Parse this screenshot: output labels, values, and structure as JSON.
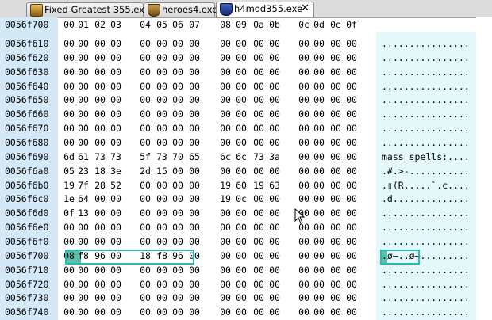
{
  "tabs": [
    {
      "label": "Fixed Greatest 355.exe",
      "active": false
    },
    {
      "label": "heroes4.exe",
      "active": false
    },
    {
      "label": "h4mod355.exe",
      "active": true
    }
  ],
  "header": {
    "current_offset": "0056f700",
    "columns": [
      "00",
      "01",
      "02",
      "03",
      "04",
      "05",
      "06",
      "07",
      "08",
      "09",
      "0a",
      "0b",
      "0c",
      "0d",
      "0e",
      "0f"
    ]
  },
  "rows": [
    {
      "addr": "0056f610",
      "bytes": [
        "00",
        "00",
        "00",
        "00",
        "00",
        "00",
        "00",
        "00",
        "00",
        "00",
        "00",
        "00",
        "00",
        "00",
        "00",
        "00"
      ],
      "ascii": "................"
    },
    {
      "addr": "0056f620",
      "bytes": [
        "00",
        "00",
        "00",
        "00",
        "00",
        "00",
        "00",
        "00",
        "00",
        "00",
        "00",
        "00",
        "00",
        "00",
        "00",
        "00"
      ],
      "ascii": "................"
    },
    {
      "addr": "0056f630",
      "bytes": [
        "00",
        "00",
        "00",
        "00",
        "00",
        "00",
        "00",
        "00",
        "00",
        "00",
        "00",
        "00",
        "00",
        "00",
        "00",
        "00"
      ],
      "ascii": "................"
    },
    {
      "addr": "0056f640",
      "bytes": [
        "00",
        "00",
        "00",
        "00",
        "00",
        "00",
        "00",
        "00",
        "00",
        "00",
        "00",
        "00",
        "00",
        "00",
        "00",
        "00"
      ],
      "ascii": "................"
    },
    {
      "addr": "0056f650",
      "bytes": [
        "00",
        "00",
        "00",
        "00",
        "00",
        "00",
        "00",
        "00",
        "00",
        "00",
        "00",
        "00",
        "00",
        "00",
        "00",
        "00"
      ],
      "ascii": "................"
    },
    {
      "addr": "0056f660",
      "bytes": [
        "00",
        "00",
        "00",
        "00",
        "00",
        "00",
        "00",
        "00",
        "00",
        "00",
        "00",
        "00",
        "00",
        "00",
        "00",
        "00"
      ],
      "ascii": "................"
    },
    {
      "addr": "0056f670",
      "bytes": [
        "00",
        "00",
        "00",
        "00",
        "00",
        "00",
        "00",
        "00",
        "00",
        "00",
        "00",
        "00",
        "00",
        "00",
        "00",
        "00"
      ],
      "ascii": "................"
    },
    {
      "addr": "0056f680",
      "bytes": [
        "00",
        "00",
        "00",
        "00",
        "00",
        "00",
        "00",
        "00",
        "00",
        "00",
        "00",
        "00",
        "00",
        "00",
        "00",
        "00"
      ],
      "ascii": "................"
    },
    {
      "addr": "0056f690",
      "bytes": [
        "6d",
        "61",
        "73",
        "73",
        "5f",
        "73",
        "70",
        "65",
        "6c",
        "6c",
        "73",
        "3a",
        "00",
        "00",
        "00",
        "00"
      ],
      "ascii": "mass_spells:...."
    },
    {
      "addr": "0056f6a0",
      "bytes": [
        "05",
        "23",
        "18",
        "3e",
        "2d",
        "15",
        "00",
        "00",
        "00",
        "00",
        "00",
        "00",
        "00",
        "00",
        "00",
        "00"
      ],
      "ascii": ".#.>-..........."
    },
    {
      "addr": "0056f6b0",
      "bytes": [
        "19",
        "7f",
        "28",
        "52",
        "00",
        "00",
        "00",
        "00",
        "19",
        "60",
        "19",
        "63",
        "00",
        "00",
        "00",
        "00"
      ],
      "ascii": ".▯(R.....`.c...."
    },
    {
      "addr": "0056f6c0",
      "bytes": [
        "1e",
        "64",
        "00",
        "00",
        "00",
        "00",
        "00",
        "00",
        "19",
        "0c",
        "00",
        "00",
        "00",
        "00",
        "00",
        "00"
      ],
      "ascii": ".d.............."
    },
    {
      "addr": "0056f6d0",
      "bytes": [
        "0f",
        "13",
        "00",
        "00",
        "00",
        "00",
        "00",
        "00",
        "00",
        "00",
        "00",
        "00",
        "00",
        "00",
        "00",
        "00"
      ],
      "ascii": "................"
    },
    {
      "addr": "0056f6e0",
      "bytes": [
        "00",
        "00",
        "00",
        "00",
        "00",
        "00",
        "00",
        "00",
        "00",
        "00",
        "00",
        "00",
        "00",
        "00",
        "00",
        "00"
      ],
      "ascii": "................"
    },
    {
      "addr": "0056f6f0",
      "bytes": [
        "00",
        "00",
        "00",
        "00",
        "00",
        "00",
        "00",
        "00",
        "00",
        "00",
        "00",
        "00",
        "00",
        "00",
        "00",
        "00"
      ],
      "ascii": "................"
    },
    {
      "addr": "0056f700",
      "bytes": [
        "08",
        "f8",
        "96",
        "00",
        "18",
        "f8",
        "96",
        "00",
        "00",
        "00",
        "00",
        "00",
        "00",
        "00",
        "00",
        "00"
      ],
      "ascii": ".ø–..ø–........."
    },
    {
      "addr": "0056f710",
      "bytes": [
        "00",
        "00",
        "00",
        "00",
        "00",
        "00",
        "00",
        "00",
        "00",
        "00",
        "00",
        "00",
        "00",
        "00",
        "00",
        "00"
      ],
      "ascii": "................"
    },
    {
      "addr": "0056f720",
      "bytes": [
        "00",
        "00",
        "00",
        "00",
        "00",
        "00",
        "00",
        "00",
        "00",
        "00",
        "00",
        "00",
        "00",
        "00",
        "00",
        "00"
      ],
      "ascii": "................"
    },
    {
      "addr": "0056f730",
      "bytes": [
        "00",
        "00",
        "00",
        "00",
        "00",
        "00",
        "00",
        "00",
        "00",
        "00",
        "00",
        "00",
        "00",
        "00",
        "00",
        "00"
      ],
      "ascii": "................"
    },
    {
      "addr": "0056f740",
      "bytes": [
        "00",
        "00",
        "00",
        "00",
        "00",
        "00",
        "00",
        "00",
        "00",
        "00",
        "00",
        "00",
        "00",
        "00",
        "00",
        "00"
      ],
      "ascii": "................"
    }
  ],
  "colors": {
    "address_column": "#d4e9f7",
    "ascii_panel": "#e4f8fb",
    "cursor": "#5cbfa8",
    "selection_border": "#2cb6b6"
  },
  "icons": [
    "treasure-chest-icon",
    "heroes-shield-icon",
    "h4mod-shield-icon",
    "close-icon",
    "mouse-pointer-icon"
  ]
}
